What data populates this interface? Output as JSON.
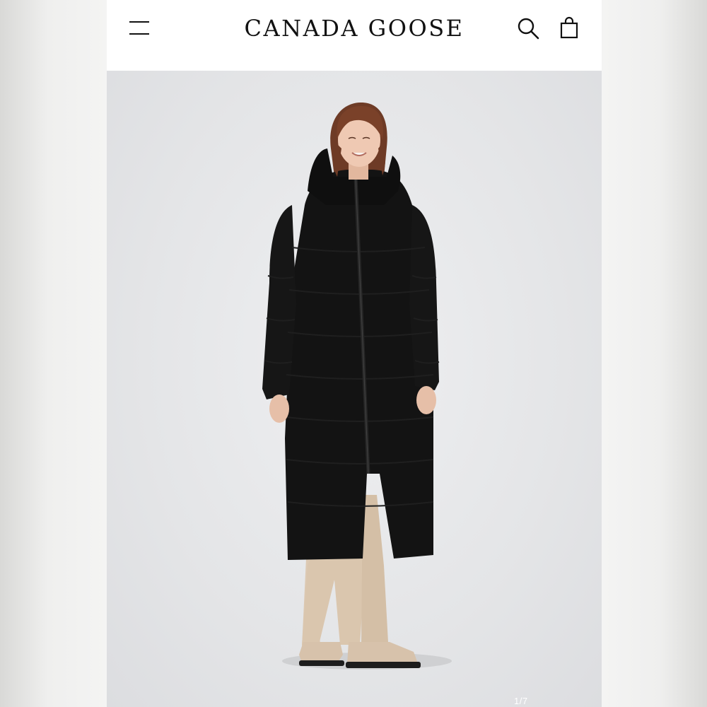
{
  "header": {
    "brand": "CANADA GOOSE",
    "icons": [
      "hamburger-menu-icon",
      "search-icon",
      "shopping-bag-icon"
    ]
  },
  "gallery": {
    "counter": "1/7"
  }
}
